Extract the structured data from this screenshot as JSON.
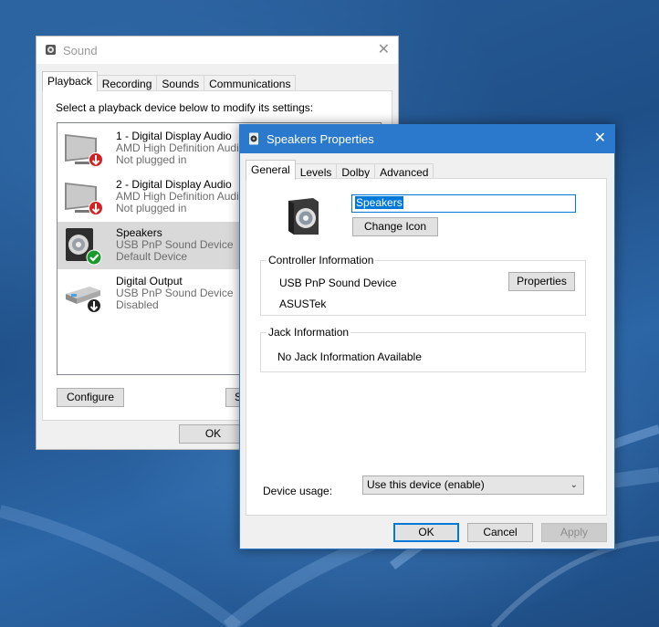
{
  "sound_dialog": {
    "title": "Sound",
    "tabs": [
      "Playback",
      "Recording",
      "Sounds",
      "Communications"
    ],
    "instruction": "Select a playback device below to modify its settings:",
    "devices": [
      {
        "name": "1 - Digital Display Audio",
        "driver": "AMD High Definition Audio",
        "status": "Not plugged in",
        "icon": "monitor-icon",
        "badge": "unplugged-badge-icon"
      },
      {
        "name": "2 - Digital Display Audio",
        "driver": "AMD High Definition Audio",
        "status": "Not plugged in",
        "icon": "monitor-icon",
        "badge": "unplugged-badge-icon"
      },
      {
        "name": "Speakers",
        "driver": "USB PnP Sound Device",
        "status": "Default Device",
        "icon": "speaker-icon",
        "badge": "default-check-badge-icon"
      },
      {
        "name": "Digital Output",
        "driver": "USB PnP Sound Device",
        "status": "Disabled",
        "icon": "digital-output-icon",
        "badge": "disabled-badge-icon"
      }
    ],
    "configure_label": "Configure",
    "set_default_label": "S",
    "ok_label": "OK"
  },
  "props_dialog": {
    "title": "Speakers Properties",
    "tabs": [
      "General",
      "Levels",
      "Dolby",
      "Advanced"
    ],
    "device_name": "Speakers",
    "change_icon_label": "Change Icon",
    "controller": {
      "title": "Controller Information",
      "device": "USB PnP Sound Device",
      "vendor": "ASUSTek",
      "properties_label": "Properties"
    },
    "jack": {
      "title": "Jack Information",
      "text": "No Jack Information Available"
    },
    "device_usage_label": "Device usage:",
    "device_usage_value": "Use this device (enable)",
    "ok_label": "OK",
    "cancel_label": "Cancel",
    "apply_label": "Apply"
  },
  "colors": {
    "accent": "#0078d7",
    "titlebar_active": "#2b79cc",
    "selected_row": "#d9d9d9",
    "ok_green": "#1a9a2a",
    "alert_red": "#d32020"
  }
}
